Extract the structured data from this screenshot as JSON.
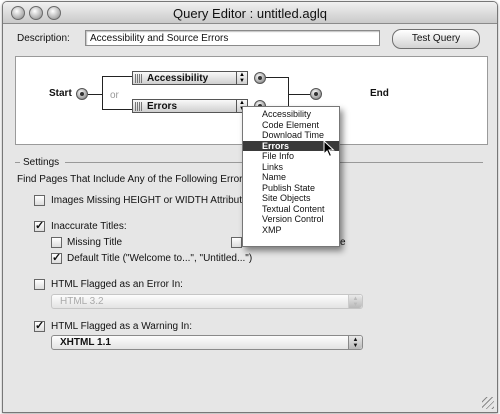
{
  "window": {
    "title": "Query Editor : untitled.aglq"
  },
  "description": {
    "label": "Description:",
    "value": "Accessibility and Source Errors"
  },
  "test_button": {
    "label": "Test Query"
  },
  "query_graph": {
    "start_label": "Start",
    "end_label": "End",
    "or_label": "or",
    "criteria": [
      "Accessibility",
      "Errors"
    ]
  },
  "criteria_menu": {
    "items": [
      "Accessibility",
      "Code Element",
      "Download Time",
      "Errors",
      "File Info",
      "Links",
      "Name",
      "Publish State",
      "Site Objects",
      "Textual Content",
      "Version Control",
      "XMP"
    ],
    "selected": "Errors"
  },
  "settings": {
    "header": "Settings",
    "intro": "Find Pages That Include Any of the Following Errors:",
    "images_missing": {
      "label": "Images Missing HEIGHT or WIDTH Attributes",
      "checked": false
    },
    "inaccurate_titles": {
      "label": "Inaccurate Titles:",
      "checked": true
    },
    "missing_title": {
      "label": "Missing Title",
      "checked": false
    },
    "hidden_option_tail": "e",
    "default_title": {
      "label": "Default Title (\"Welcome to...\", \"Untitled...\")",
      "checked": true
    },
    "html_error": {
      "label": "HTML Flagged as an Error In:",
      "checked": false,
      "value": "HTML 3.2"
    },
    "html_warning": {
      "label": "HTML Flagged as a Warning In:",
      "checked": true,
      "value": "XHTML 1.1"
    }
  },
  "icons": {
    "checked": "checkmark-icon",
    "stepper": "up-down-arrows-icon",
    "cursor": "arrow-cursor-icon",
    "grip": "grip-icon"
  }
}
